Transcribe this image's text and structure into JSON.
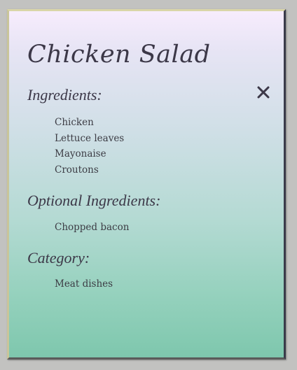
{
  "recipe": {
    "title": "Chicken Salad",
    "close_icon": "close-icon",
    "sections": {
      "ingredients": {
        "heading": "Ingredients:",
        "items": [
          "Chicken",
          "Lettuce leaves",
          "Mayonaise",
          "Croutons"
        ]
      },
      "optional": {
        "heading": "Optional Ingredients:",
        "items": [
          "Chopped bacon"
        ]
      },
      "category": {
        "heading": "Category:",
        "items": [
          "Meat dishes"
        ]
      }
    }
  },
  "colors": {
    "text": "#3c3848",
    "gradient_top": "#f7ecfd",
    "gradient_bottom": "#7ec7ad",
    "page_background": "#c2c2c0"
  }
}
